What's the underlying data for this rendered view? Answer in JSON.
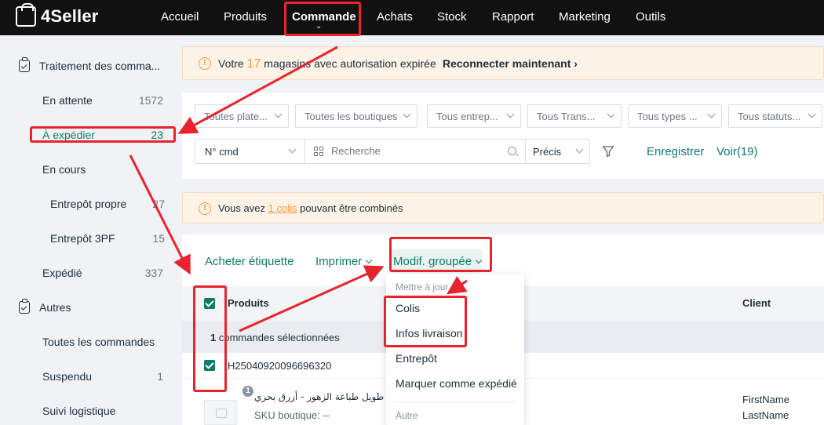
{
  "app": {
    "name": "4Seller"
  },
  "nav": {
    "items": [
      {
        "label": "Accueil"
      },
      {
        "label": "Produits"
      },
      {
        "label": "Commande"
      },
      {
        "label": "Achats"
      },
      {
        "label": "Stock"
      },
      {
        "label": "Rapport"
      },
      {
        "label": "Marketing"
      },
      {
        "label": "Outils"
      }
    ],
    "active": "Commande"
  },
  "sidebar": {
    "group1": {
      "label": "Traitement des comma..."
    },
    "group1_items": [
      {
        "label": "En attente",
        "count": "1572"
      },
      {
        "label": "À expédier",
        "count": "23"
      },
      {
        "label": "En cours",
        "count": ""
      },
      {
        "label": "Entrepôt propre",
        "count": "27"
      },
      {
        "label": "Entrepôt 3PF",
        "count": "15"
      },
      {
        "label": "Expédié",
        "count": "337"
      }
    ],
    "group2": {
      "label": "Autres"
    },
    "group2_items": [
      {
        "label": "Toutes les commandes",
        "count": ""
      },
      {
        "label": "Suspendu",
        "count": "1"
      },
      {
        "label": "Suivi logistique",
        "count": ""
      }
    ]
  },
  "alert_stores": {
    "prefix": "Votre",
    "count": "17",
    "suffix": "magasins avec autorisation expirée",
    "action": "Reconnecter maintenant",
    "icon": "warning-icon"
  },
  "filters": {
    "selects": [
      {
        "label": "Toutes plate..."
      },
      {
        "label": "Toutes les boutiques"
      },
      {
        "label": "Tous entrep..."
      },
      {
        "label": "Tous Trans..."
      },
      {
        "label": "Tous types ..."
      },
      {
        "label": "Tous statuts..."
      }
    ],
    "search_field": "N° cmd",
    "search_placeholder": "Recherche",
    "search_mode": "Précis",
    "save_label": "Enregistrer",
    "view_label": "Voir(19)"
  },
  "alert_combine": {
    "prefix": "Vous avez",
    "link": "1 colis",
    "suffix": "pouvant être combinés"
  },
  "actions": {
    "buy_label": "Acheter étiquette",
    "print_label": "Imprimer",
    "bulk_label": "Modif. groupée"
  },
  "table": {
    "headers": {
      "products": "Produits",
      "client": "Client"
    },
    "selected_count": "1",
    "selected_text": "commandes sélectionnées",
    "order_id": "H25040920096696320",
    "product_title": "فستان طويل طباعة الزهور - أزرق بحري",
    "product_sku_label": "SKU boutique: --",
    "product_qty": "1",
    "client_first": "FirstName",
    "client_last": "LastName"
  },
  "dropdown": {
    "group_update": "Mettre à jour",
    "items": [
      {
        "label": "Colis"
      },
      {
        "label": "Infos livraison"
      },
      {
        "label": "Entrepôt"
      },
      {
        "label": "Marquer comme expédié"
      }
    ],
    "group_other": "Autre"
  },
  "colors": {
    "accent": "#0d7d67",
    "annotation": "#e8232e",
    "warning": "#f29c38",
    "topbar": "#111111"
  }
}
